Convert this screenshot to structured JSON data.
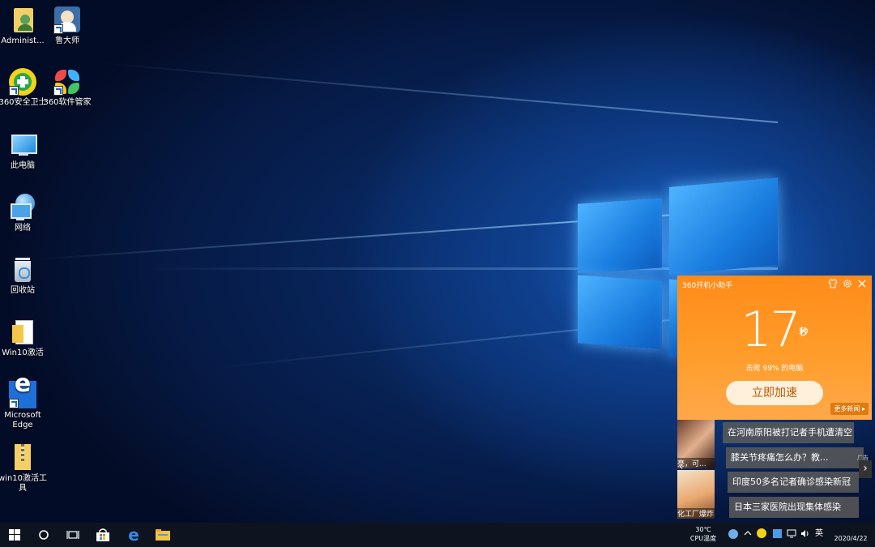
{
  "desktop": {
    "icons": [
      {
        "label": "Administ..."
      },
      {
        "label": "鲁大师"
      },
      {
        "label": "360安全卫士"
      },
      {
        "label": "360软件管家"
      },
      {
        "label": "此电脑"
      },
      {
        "label": "网络"
      },
      {
        "label": "回收站"
      },
      {
        "label": "Win10激活"
      },
      {
        "label": "Microsoft Edge"
      },
      {
        "label": "win10激活工具"
      }
    ]
  },
  "widget": {
    "title": "360开机小助手",
    "time_value": "17",
    "time_unit": "秒",
    "rank_text": "击败 99% 的电脑",
    "speedup_label": "立即加速",
    "more_news_label": "更多新闻 ▸",
    "icons": [
      "shirt-icon",
      "gear-icon",
      "close-icon"
    ]
  },
  "news": {
    "thumbs": [
      {
        "caption": "亮，可..."
      },
      {
        "caption": "化工厂爆炸"
      }
    ],
    "headlines": [
      "在河南原阳被打记者手机遭清空",
      "膝关节疼痛怎么办？教...",
      "印度50多名记者确诊感染新冠",
      "日本三家医院出现集体感染"
    ],
    "ad_tag": "广告",
    "prev_icon": "‹",
    "next_icon": "›"
  },
  "taskbar": {
    "cpu_temp": "30℃",
    "cpu_label": "CPU温度",
    "ime": "英",
    "date": "2020/4/22"
  },
  "colors": {
    "widget_orange": "#ff8b1a",
    "taskbar": "#0d1420",
    "desktop_blue": "#0a3275"
  }
}
